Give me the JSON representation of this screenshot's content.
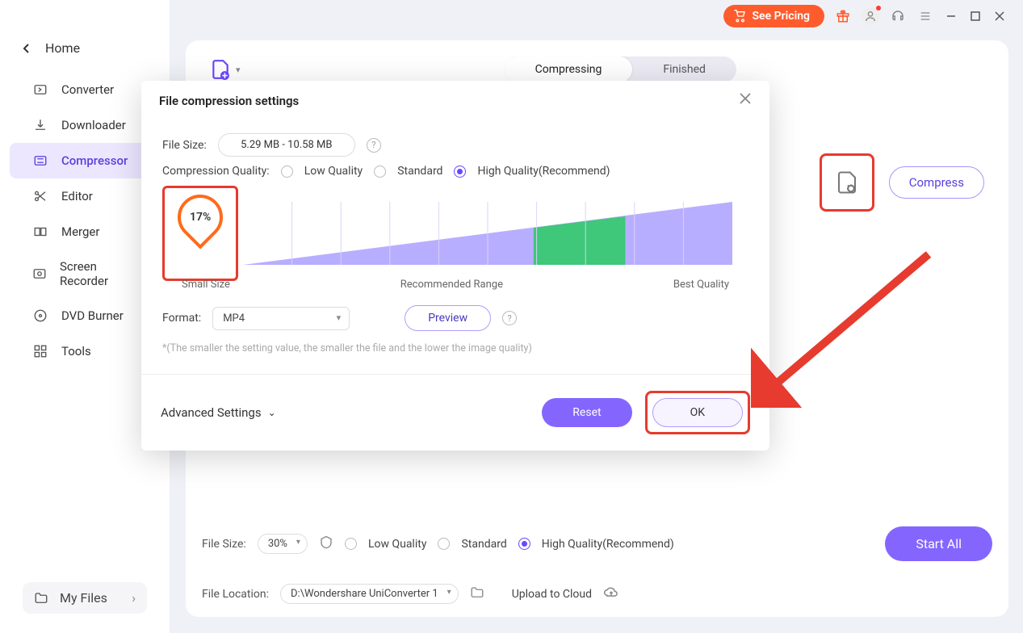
{
  "topbar": {
    "see_pricing": "See Pricing"
  },
  "sidebar": {
    "home": "Home",
    "items": [
      {
        "label": "Converter"
      },
      {
        "label": "Downloader"
      },
      {
        "label": "Compressor"
      },
      {
        "label": "Editor"
      },
      {
        "label": "Merger"
      },
      {
        "label": "Screen Recorder"
      },
      {
        "label": "DVD Burner"
      },
      {
        "label": "Tools"
      }
    ],
    "myfiles": "My Files"
  },
  "main": {
    "tabs": {
      "compressing": "Compressing",
      "finished": "Finished"
    },
    "compress_btn": "Compress"
  },
  "bottombar": {
    "file_size_label": "File Size:",
    "file_size_value": "30%",
    "low": "Low Quality",
    "standard": "Standard",
    "high": "High Quality(Recommend)",
    "file_location_label": "File Location:",
    "file_location_value": "D:\\Wondershare UniConverter 1",
    "upload": "Upload to Cloud",
    "start_all": "Start All"
  },
  "modal": {
    "title": "File compression settings",
    "file_size_label": "File Size:",
    "file_size_value": "5.29 MB - 10.58 MB",
    "quality_label": "Compression Quality:",
    "q_low": "Low Quality",
    "q_standard": "Standard",
    "q_high": "High Quality(Recommend)",
    "percent": "17%",
    "small_size": "Small Size",
    "recommended": "Recommended Range",
    "best_quality": "Best Quality",
    "format_label": "Format:",
    "format_value": "MP4",
    "preview": "Preview",
    "note": "*(The smaller the setting value, the smaller the file and the lower the image quality)",
    "advanced": "Advanced Settings",
    "reset": "Reset",
    "ok": "OK"
  }
}
